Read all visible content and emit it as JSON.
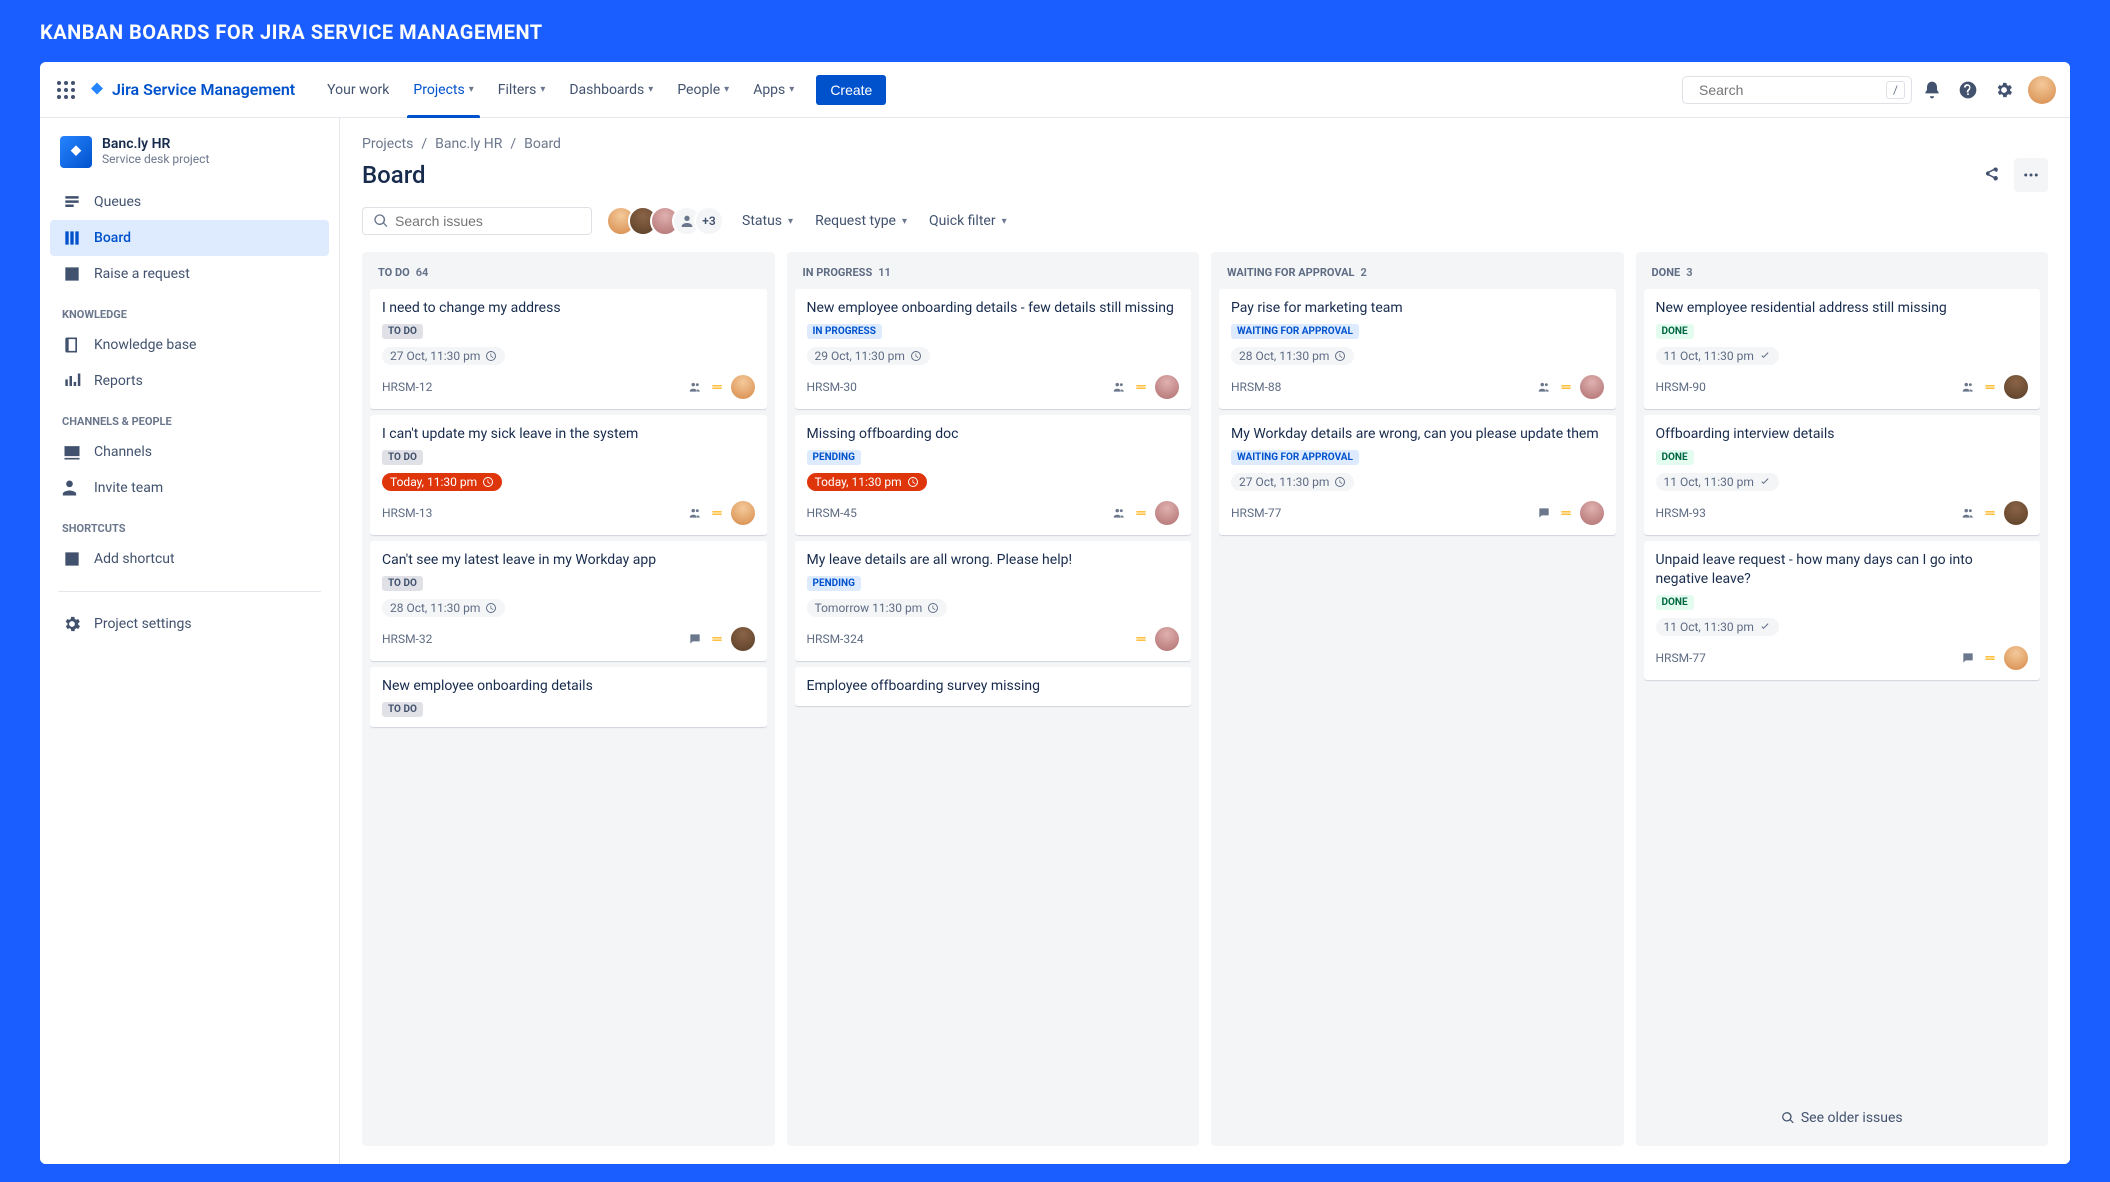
{
  "page_heading": "KANBAN BOARDS FOR JIRA SERVICE MANAGEMENT",
  "product": "Jira Service Management",
  "top_nav": {
    "your_work": "Your work",
    "projects": "Projects",
    "filters": "Filters",
    "dashboards": "Dashboards",
    "people": "People",
    "apps": "Apps",
    "create": "Create"
  },
  "search": {
    "placeholder": "Search",
    "shortcut": "/"
  },
  "sidebar": {
    "project_name": "Banc.ly HR",
    "project_type": "Service desk project",
    "items_main": [
      {
        "label": "Queues"
      },
      {
        "label": "Board"
      },
      {
        "label": "Raise a request"
      }
    ],
    "heading_knowledge": "KNOWLEDGE",
    "items_knowledge": [
      {
        "label": "Knowledge base"
      },
      {
        "label": "Reports"
      }
    ],
    "heading_channels": "CHANNELS & PEOPLE",
    "items_channels": [
      {
        "label": "Channels"
      },
      {
        "label": "Invite team"
      }
    ],
    "heading_shortcuts": "SHORTCUTS",
    "add_shortcut": "Add shortcut",
    "project_settings": "Project settings"
  },
  "breadcrumb": {
    "a": "Projects",
    "b": "Banc.ly HR",
    "c": "Board"
  },
  "board_title": "Board",
  "issue_search_placeholder": "Search issues",
  "avatar_extra": "+3",
  "filters": {
    "status": "Status",
    "request_type": "Request type",
    "quick_filter": "Quick filter"
  },
  "columns": [
    {
      "name": "TO DO",
      "count": "64"
    },
    {
      "name": "IN PROGRESS",
      "count": "11"
    },
    {
      "name": "WAITING FOR APPROVAL",
      "count": "2"
    },
    {
      "name": "DONE",
      "count": "3"
    }
  ],
  "cards": {
    "c0": [
      {
        "title": "I need to change my address",
        "status": "TO DO",
        "status_class": "lz-todo",
        "date": "27 Oct, 11:30 pm",
        "date_class": "date-neutral",
        "key": "HRSM-12",
        "show_users": true,
        "show_comment": false,
        "av": "av0"
      },
      {
        "title": "I can't update my sick leave in the system",
        "status": "TO DO",
        "status_class": "lz-todo",
        "date": "Today, 11:30 pm",
        "date_class": "date-overdue",
        "key": "HRSM-13",
        "show_users": true,
        "show_comment": false,
        "av": "av0"
      },
      {
        "title": "Can't see my latest leave in my Workday app",
        "status": "TO DO",
        "status_class": "lz-todo",
        "date": "28 Oct, 11:30 pm",
        "date_class": "date-neutral",
        "key": "HRSM-32",
        "show_users": false,
        "show_comment": true,
        "av": "av1"
      },
      {
        "title": "New employee onboarding details",
        "status": "TO DO",
        "status_class": "lz-todo",
        "date": "",
        "date_class": "",
        "key": "",
        "show_users": false,
        "show_comment": false,
        "av": ""
      }
    ],
    "c1": [
      {
        "title": "New employee onboarding details - few details still missing",
        "status": "IN PROGRESS",
        "status_class": "lz-progress",
        "date": "29 Oct, 11:30 pm",
        "date_class": "date-neutral",
        "key": "HRSM-30",
        "show_users": true,
        "show_comment": false,
        "av": "av2"
      },
      {
        "title": "Missing offboarding doc",
        "status": "PENDING",
        "status_class": "lz-pending",
        "date": "Today, 11:30 pm",
        "date_class": "date-overdue",
        "key": "HRSM-45",
        "show_users": true,
        "show_comment": false,
        "av": "av2"
      },
      {
        "title": "My leave details are all wrong. Please help!",
        "status": "PENDING",
        "status_class": "lz-pending",
        "date": "Tomorrow 11:30 pm",
        "date_class": "date-neutral",
        "key": "HRSM-324",
        "show_users": false,
        "show_comment": false,
        "av": "av2"
      },
      {
        "title": "Employee offboarding survey missing",
        "status": "",
        "status_class": "",
        "date": "",
        "date_class": "",
        "key": "",
        "show_users": false,
        "show_comment": false,
        "av": ""
      }
    ],
    "c2": [
      {
        "title": "Pay rise for marketing team",
        "status": "WAITING FOR APPROVAL",
        "status_class": "lz-waiting",
        "date": "28 Oct, 11:30 pm",
        "date_class": "date-neutral",
        "key": "HRSM-88",
        "show_users": true,
        "show_comment": false,
        "av": "av2"
      },
      {
        "title": "My Workday details are wrong, can you please update them",
        "status": "WAITING FOR APPROVAL",
        "status_class": "lz-waiting",
        "date": "27 Oct, 11:30 pm",
        "date_class": "date-neutral",
        "key": "HRSM-77",
        "show_users": false,
        "show_comment": true,
        "av": "av2"
      }
    ],
    "c3": [
      {
        "title": "New employee residential address still  missing",
        "status": "DONE",
        "status_class": "lz-done",
        "date": "11 Oct, 11:30 pm",
        "date_class": "date-neutral",
        "key": "HRSM-90",
        "show_users": true,
        "show_comment": false,
        "av": "av1",
        "done_check": true
      },
      {
        "title": "Offboarding interview details",
        "status": "DONE",
        "status_class": "lz-done",
        "date": "11 Oct, 11:30 pm",
        "date_class": "date-neutral",
        "key": "HRSM-93",
        "show_users": true,
        "show_comment": false,
        "av": "av1",
        "done_check": true
      },
      {
        "title": "Unpaid leave request - how many days can I go into negative leave?",
        "status": "DONE",
        "status_class": "lz-done",
        "date": "11 Oct, 11:30 pm",
        "date_class": "date-neutral",
        "key": "HRSM-77",
        "show_users": false,
        "show_comment": true,
        "av": "av0",
        "done_check": true
      }
    ]
  },
  "see_older": "See older issues"
}
